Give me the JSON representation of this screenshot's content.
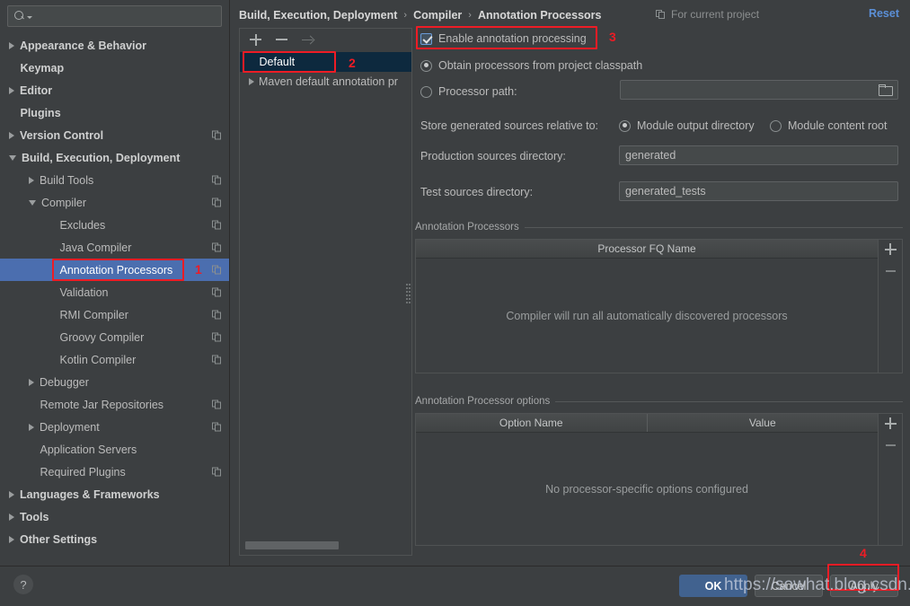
{
  "search": {
    "placeholder": "",
    "value": "",
    "icon": "search-icon"
  },
  "sidebar": {
    "items": [
      {
        "label": "Appearance & Behavior",
        "arrow": "right",
        "bold": true,
        "indent": 0,
        "copy": false,
        "selected": false
      },
      {
        "label": "Keymap",
        "arrow": "none",
        "bold": true,
        "indent": 0,
        "copy": false,
        "selected": false
      },
      {
        "label": "Editor",
        "arrow": "right",
        "bold": true,
        "indent": 0,
        "copy": false,
        "selected": false
      },
      {
        "label": "Plugins",
        "arrow": "none",
        "bold": true,
        "indent": 0,
        "copy": false,
        "selected": false
      },
      {
        "label": "Version Control",
        "arrow": "right",
        "bold": true,
        "indent": 0,
        "copy": true,
        "selected": false
      },
      {
        "label": "Build, Execution, Deployment",
        "arrow": "down",
        "bold": true,
        "indent": 0,
        "copy": false,
        "selected": false
      },
      {
        "label": "Build Tools",
        "arrow": "right",
        "bold": false,
        "indent": 1,
        "copy": true,
        "selected": false
      },
      {
        "label": "Compiler",
        "arrow": "down",
        "bold": false,
        "indent": 1,
        "copy": true,
        "selected": false
      },
      {
        "label": "Excludes",
        "arrow": "none",
        "bold": false,
        "indent": 2,
        "copy": true,
        "selected": false
      },
      {
        "label": "Java Compiler",
        "arrow": "none",
        "bold": false,
        "indent": 2,
        "copy": true,
        "selected": false
      },
      {
        "label": "Annotation Processors",
        "arrow": "none",
        "bold": false,
        "indent": 2,
        "copy": true,
        "selected": true
      },
      {
        "label": "Validation",
        "arrow": "none",
        "bold": false,
        "indent": 2,
        "copy": true,
        "selected": false
      },
      {
        "label": "RMI Compiler",
        "arrow": "none",
        "bold": false,
        "indent": 2,
        "copy": true,
        "selected": false
      },
      {
        "label": "Groovy Compiler",
        "arrow": "none",
        "bold": false,
        "indent": 2,
        "copy": true,
        "selected": false
      },
      {
        "label": "Kotlin Compiler",
        "arrow": "none",
        "bold": false,
        "indent": 2,
        "copy": true,
        "selected": false
      },
      {
        "label": "Debugger",
        "arrow": "right",
        "bold": false,
        "indent": 1,
        "copy": false,
        "selected": false
      },
      {
        "label": "Remote Jar Repositories",
        "arrow": "none",
        "bold": false,
        "indent": 1,
        "copy": true,
        "selected": false
      },
      {
        "label": "Deployment",
        "arrow": "right",
        "bold": false,
        "indent": 1,
        "copy": true,
        "selected": false
      },
      {
        "label": "Application Servers",
        "arrow": "none",
        "bold": false,
        "indent": 1,
        "copy": false,
        "selected": false
      },
      {
        "label": "Required Plugins",
        "arrow": "none",
        "bold": false,
        "indent": 1,
        "copy": true,
        "selected": false
      },
      {
        "label": "Languages & Frameworks",
        "arrow": "right",
        "bold": true,
        "indent": 0,
        "copy": false,
        "selected": false
      },
      {
        "label": "Tools",
        "arrow": "right",
        "bold": true,
        "indent": 0,
        "copy": false,
        "selected": false
      },
      {
        "label": "Other Settings",
        "arrow": "right",
        "bold": true,
        "indent": 0,
        "copy": false,
        "selected": false
      }
    ]
  },
  "breadcrumb": {
    "crumbs": [
      "Build, Execution, Deployment",
      "Compiler",
      "Annotation Processors"
    ],
    "separator": "›",
    "scope_label": "For current project",
    "scope_icon": "copy-icon",
    "reset_label": "Reset"
  },
  "profile_panel": {
    "toolbar": {
      "add": "+",
      "remove": "−",
      "move": "→"
    },
    "items": [
      {
        "label": "Default",
        "arrow": "none",
        "selected": true
      },
      {
        "label": "Maven default annotation pr",
        "arrow": "right",
        "selected": false
      }
    ]
  },
  "main": {
    "enable_processing": {
      "label": "Enable annotation processing",
      "checked": true
    },
    "obtain_from_classpath": {
      "label": "Obtain processors from project classpath",
      "selected": true
    },
    "processor_path": {
      "label": "Processor path:",
      "selected": false,
      "value": "",
      "browse_icon": "folder-icon"
    },
    "store_relative": {
      "label": "Store generated sources relative to:",
      "options": [
        {
          "label": "Module output directory",
          "selected": true
        },
        {
          "label": "Module content root",
          "selected": false
        }
      ]
    },
    "production_sources": {
      "label": "Production sources directory:",
      "value": "generated"
    },
    "test_sources": {
      "label": "Test sources directory:",
      "value": "generated_tests"
    },
    "processors_group": {
      "title": "Annotation Processors",
      "columns": [
        "Processor FQ Name"
      ],
      "rows": [],
      "empty_text": "Compiler will run all automatically discovered processors",
      "add_label": "+",
      "remove_label": "−"
    },
    "options_group": {
      "title": "Annotation Processor options",
      "columns": [
        "Option Name",
        "Value"
      ],
      "rows": [],
      "empty_text": "No processor-specific options configured",
      "add_label": "+",
      "remove_label": "−"
    }
  },
  "bottom": {
    "help_label": "?",
    "ok_label": "OK",
    "cancel_label": "Cancel",
    "apply_label": "Apply"
  },
  "annotations": {
    "n1": "1",
    "n2": "2",
    "n3": "3",
    "n4": "4",
    "highlight_color": "#ee1c25"
  },
  "watermark": {
    "text": "https://sowhat.blog.csdn.net"
  }
}
